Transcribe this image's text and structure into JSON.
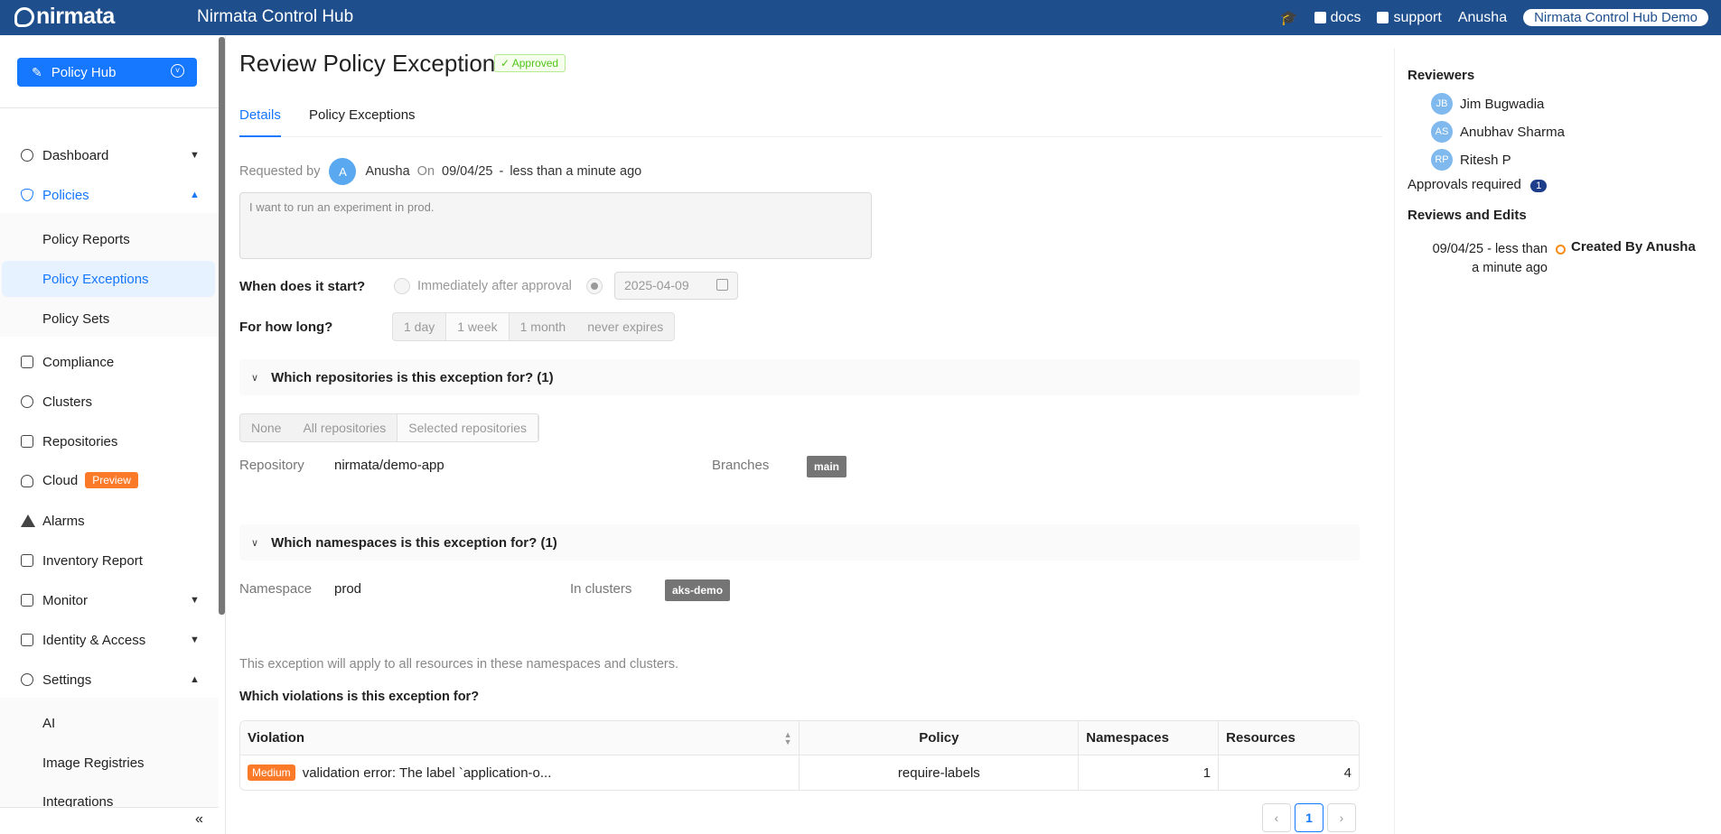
{
  "topbar": {
    "logo": "nirmata",
    "app_title": "Nirmata Control Hub",
    "docs": "docs",
    "support": "support",
    "user": "Anusha",
    "org": "Nirmata Control Hub Demo"
  },
  "sidebar": {
    "hub_button": "Policy Hub",
    "items": {
      "dashboard": "Dashboard",
      "policies": "Policies",
      "policy_reports": "Policy Reports",
      "policy_exceptions": "Policy Exceptions",
      "policy_sets": "Policy Sets",
      "compliance": "Compliance",
      "clusters": "Clusters",
      "repositories": "Repositories",
      "cloud": "Cloud",
      "cloud_badge": "Preview",
      "alarms": "Alarms",
      "inventory_report": "Inventory Report",
      "monitor": "Monitor",
      "identity_access": "Identity & Access",
      "settings": "Settings",
      "ai": "AI",
      "image_registries": "Image Registries",
      "integrations": "Integrations"
    }
  },
  "main": {
    "title": "Review Policy Exception",
    "status": "Approved",
    "tabs": [
      "Details",
      "Policy Exceptions"
    ],
    "requested_by_label": "Requested by",
    "requester_initial": "A",
    "requester": "Anusha",
    "on_label": "On",
    "date": "09/04/25",
    "dash": "-",
    "relative_time": "less than a minute ago",
    "reason": "I want to run an experiment in prod.",
    "start_label": "When does it start?",
    "start_option_immediate": "Immediately after approval",
    "start_date": "2025-04-09",
    "duration_label": "For how long?",
    "duration_options": [
      "1 day",
      "1 week",
      "1 month",
      "never expires"
    ],
    "repos_section": "Which repositories is this exception for? (1)",
    "repo_options": [
      "None",
      "All repositories",
      "Selected repositories"
    ],
    "repository_label": "Repository",
    "repository_value": "nirmata/demo-app",
    "branches_label": "Branches",
    "branch_tag": "main",
    "ns_section": "Which namespaces is this exception for? (1)",
    "namespace_label": "Namespace",
    "namespace_value": "prod",
    "clusters_label": "In clusters",
    "cluster_tag": "aks-demo",
    "apply_note": "This exception will apply to all resources in these namespaces and clusters.",
    "violations_label": "Which violations is this exception for?",
    "table": {
      "headers": [
        "Violation",
        "Policy",
        "Namespaces",
        "Resources"
      ],
      "rows": [
        {
          "severity": "Medium",
          "violation": "validation error: The label `application-o...",
          "policy": "require-labels",
          "namespaces": "1",
          "resources": "4"
        }
      ]
    },
    "pagination": {
      "current": "1"
    }
  },
  "right": {
    "reviewers_title": "Reviewers",
    "reviewers": [
      {
        "initials": "JB",
        "name": "Jim Bugwadia"
      },
      {
        "initials": "AS",
        "name": "Anubhav Sharma"
      },
      {
        "initials": "RP",
        "name": "Ritesh P"
      }
    ],
    "approvals_label": "Approvals required",
    "approvals_count": "1",
    "reviews_title": "Reviews and Edits",
    "history_date": "09/04/25",
    "history_dash": "-",
    "history_rel_1": "less than",
    "history_rel_2": "a minute ago",
    "history_event": "Created By Anusha"
  },
  "colors": {
    "brand": "#1e4e8c",
    "accent": "#1677ff",
    "approved": "#52c41a",
    "medium": "#fa7a29"
  }
}
